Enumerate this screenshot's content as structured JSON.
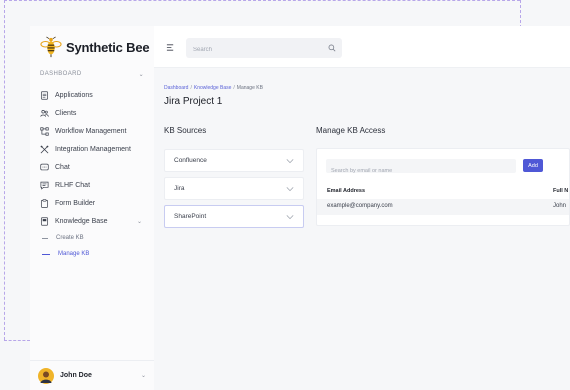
{
  "brand": {
    "name": "Synthetic Bee",
    "accent": "#4f58d6"
  },
  "sidebar": {
    "section_label": "DASHBOARD",
    "items": [
      {
        "label": "Applications",
        "icon": "document-icon"
      },
      {
        "label": "Clients",
        "icon": "users-icon"
      },
      {
        "label": "Workflow Management",
        "icon": "workflow-icon"
      },
      {
        "label": "Integration Management",
        "icon": "tools-icon"
      },
      {
        "label": "Chat",
        "icon": "chat-icon"
      },
      {
        "label": "RLHF Chat",
        "icon": "message-icon"
      },
      {
        "label": "Form Builder",
        "icon": "clipboard-icon"
      },
      {
        "label": "Knowledge Base",
        "icon": "book-icon"
      }
    ],
    "sub_items": [
      {
        "label": "Create KB"
      },
      {
        "label": "Manage KB"
      }
    ]
  },
  "user": {
    "name": "John Doe"
  },
  "topbar": {
    "search_placeholder": "Search"
  },
  "breadcrumb": {
    "items": [
      "Dashboard",
      "Knowledge Base",
      "Manage KB"
    ]
  },
  "page": {
    "title": "Jira Project 1"
  },
  "kb_sources": {
    "heading": "KB Sources",
    "items": [
      {
        "label": "Confluence"
      },
      {
        "label": "Jira"
      },
      {
        "label": "SharePoint"
      }
    ]
  },
  "access": {
    "heading": "Manage KB Access",
    "search_placeholder": "Search by email or name",
    "add_label": "Add",
    "columns": [
      "Email Address",
      "Full N"
    ],
    "rows": [
      {
        "email": "example@company.com",
        "name": "John"
      }
    ]
  }
}
